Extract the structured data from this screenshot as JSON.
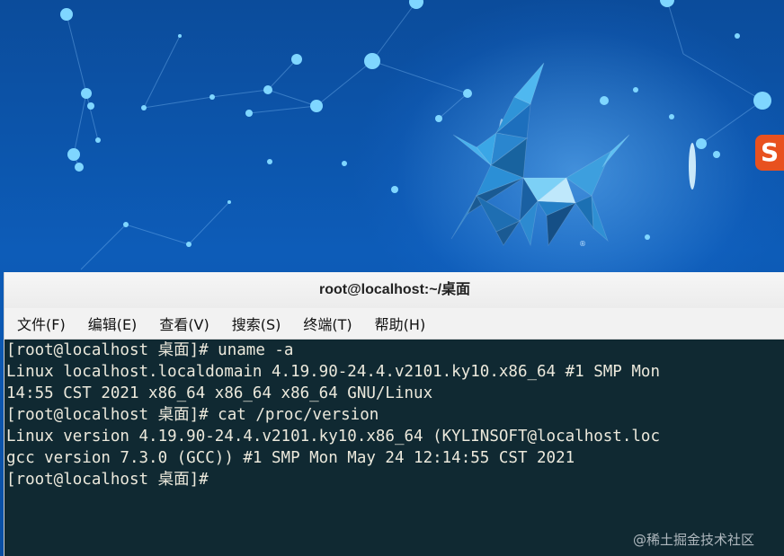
{
  "desktop": {
    "sogou_badge": "S"
  },
  "terminal": {
    "title": "root@localhost:~/桌面",
    "menu": [
      {
        "label": "文件(F)"
      },
      {
        "label": "编辑(E)"
      },
      {
        "label": "查看(V)"
      },
      {
        "label": "搜索(S)"
      },
      {
        "label": "终端(T)"
      },
      {
        "label": "帮助(H)"
      }
    ],
    "lines": [
      "[root@localhost 桌面]# uname -a",
      "Linux localhost.localdomain 4.19.90-24.4.v2101.ky10.x86_64 #1 SMP Mon",
      "14:55 CST 2021 x86_64 x86_64 x86_64 GNU/Linux",
      "[root@localhost 桌面]# cat /proc/version",
      "Linux version 4.19.90-24.4.v2101.ky10.x86_64 (KYLINSOFT@localhost.loc",
      "gcc version 7.3.0 (GCC)) #1 SMP Mon May 24 12:14:55 CST 2021",
      "[root@localhost 桌面]#"
    ]
  },
  "watermark": "@稀土掘金技术社区",
  "colors": {
    "desktop_blue": "#0b4c9b",
    "terminal_bg": "#102932",
    "terminal_fg": "#ece9dc",
    "sogou_orange": "#e8511f"
  }
}
